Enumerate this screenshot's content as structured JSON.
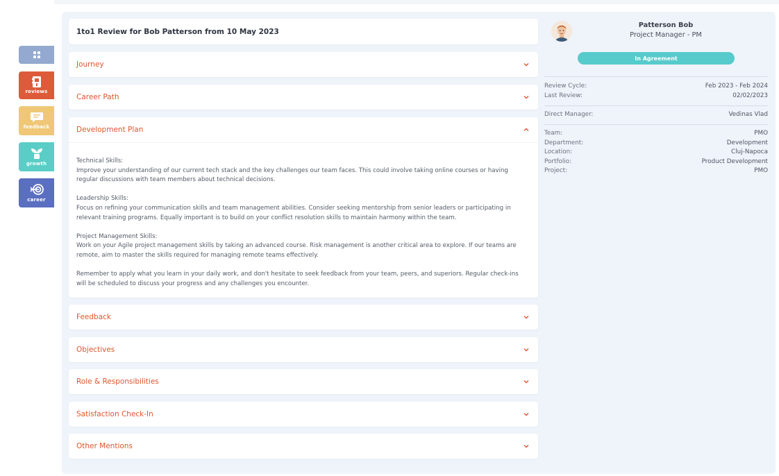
{
  "sidebar": {
    "items": [
      {
        "id": "home",
        "label": "",
        "color": "#93a9cf",
        "icon": "grid-icon"
      },
      {
        "id": "reviews",
        "label": "reviews",
        "color": "#dd5b3a",
        "icon": "document-icon"
      },
      {
        "id": "feedback",
        "label": "feedback",
        "color": "#efc777",
        "icon": "chat-bubble-icon"
      },
      {
        "id": "growth",
        "label": "growth",
        "color": "#5bcdc7",
        "icon": "sprout-icon"
      },
      {
        "id": "career",
        "label": "career",
        "color": "#5b6fc0",
        "icon": "target-icon"
      }
    ]
  },
  "review": {
    "title": "1to1 Review for Bob Patterson from 10 May 2023",
    "sections": [
      {
        "title": "Journey",
        "expanded": false
      },
      {
        "title": "Career Path",
        "expanded": false
      },
      {
        "title": "Development Plan",
        "expanded": true
      },
      {
        "title": "Feedback",
        "expanded": false
      },
      {
        "title": "Objectives",
        "expanded": false
      },
      {
        "title": "Role & Responsibilities",
        "expanded": false
      },
      {
        "title": "Satisfaction Check-In",
        "expanded": false
      },
      {
        "title": "Other Mentions",
        "expanded": false
      }
    ],
    "development_plan": {
      "technical_heading": "Technical Skills:",
      "technical_text": "Improve your understanding of our current tech stack and the key challenges our team faces. This could involve taking online courses or having regular discussions with team members about technical decisions.",
      "leadership_heading": "Leadership Skills:",
      "leadership_text": "Focus on refining your communication skills and team management abilities. Consider seeking mentorship from senior leaders or participating in relevant training programs. Equally important is to build on your conflict resolution skills to maintain harmony within the team.",
      "pm_heading": "Project Management Skills:",
      "pm_text": "Work on your Agile project management skills by taking an advanced course. Risk management is another critical area to explore. If our teams are remote, aim to master the skills required for managing remote teams effectively.",
      "closing_text": "Remember to apply what you learn in your daily work, and don't hesitate to seek feedback from your team, peers, and superiors. Regular check-ins will be scheduled to discuss your progress and any challenges you encounter."
    }
  },
  "profile": {
    "name": "Patterson Bob",
    "role": "Project Manager - PM",
    "status": "In Agreement",
    "status_color": "#57cacb",
    "review_cycle_label": "Review Cycle:",
    "review_cycle": "Feb 2023 - Feb 2024",
    "last_review_label": "Last Review:",
    "last_review": "02/02/2023",
    "direct_manager_label": "Direct Manager:",
    "direct_manager": "Vedinas Vlad",
    "team_label": "Team:",
    "team": "PMO",
    "department_label": "Department:",
    "department": "Development",
    "location_label": "Location:",
    "location": "Cluj-Napoca",
    "portfolio_label": "Portfolio:",
    "portfolio": "Product Development",
    "project_label": "Project:",
    "project": "PMO"
  },
  "accent_color": "#e0552d"
}
